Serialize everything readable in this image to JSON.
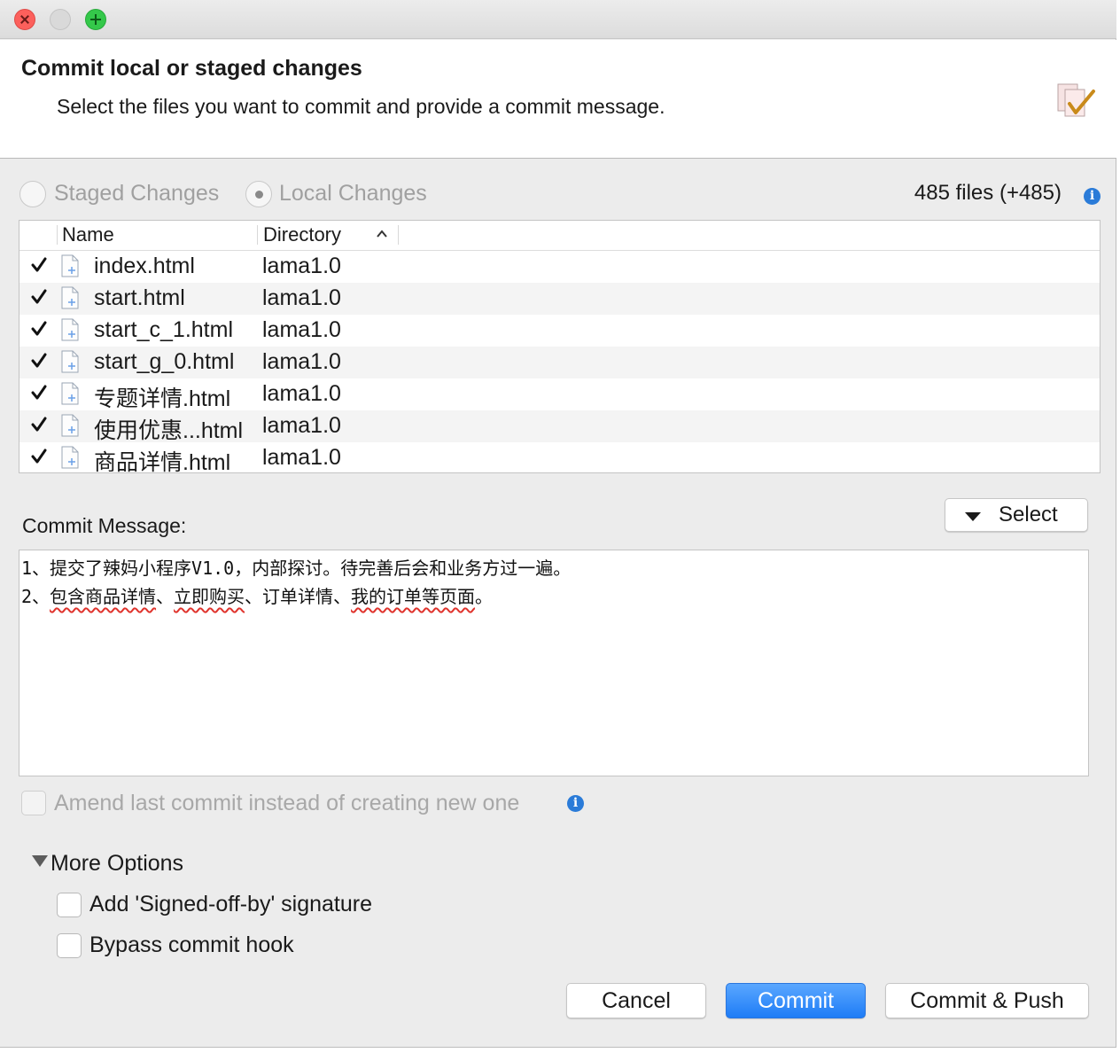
{
  "window": {
    "controls": [
      "close-icon",
      "minimize-icon",
      "maximize-icon"
    ]
  },
  "header": {
    "title": "Commit local or staged changes",
    "description": "Select the files you want to commit and provide a commit message.",
    "icon": "commit-document-check-icon"
  },
  "mode": {
    "staged_label": "Staged Changes",
    "local_label": "Local Changes",
    "selected": "Local Changes",
    "files_count": "485 files (+485)"
  },
  "table": {
    "columns": [
      "Name",
      "Directory"
    ],
    "sort_column": "Directory",
    "rows": [
      {
        "checked": true,
        "name": "index.html",
        "dir": "lama1.0"
      },
      {
        "checked": true,
        "name": "start.html",
        "dir": "lama1.0"
      },
      {
        "checked": true,
        "name": "start_c_1.html",
        "dir": "lama1.0"
      },
      {
        "checked": true,
        "name": "start_g_0.html",
        "dir": "lama1.0"
      },
      {
        "checked": true,
        "name": "专题详情.html",
        "dir": "lama1.0"
      },
      {
        "checked": true,
        "name": "使用优惠...html",
        "dir": "lama1.0"
      },
      {
        "checked": true,
        "name": "商品详情.html",
        "dir": "lama1.0"
      }
    ]
  },
  "commit": {
    "label": "Commit Message:",
    "select_label": "Select",
    "line1": "1、提交了辣妈小程序V1.0，内部探讨。待完善后会和业务方过一遍。",
    "line2_prefix": "2、",
    "line2_a": "包含商品详情",
    "line2_b": "、",
    "line2_c": "立即购买",
    "line2_d": "、订单详情、",
    "line2_e": "我的订单等页面",
    "line2_f": "。"
  },
  "amend": {
    "label": "Amend last commit instead of creating new one",
    "checked": false
  },
  "more_options": {
    "label": "More Options",
    "signed_off_label": "Add 'Signed-off-by' signature",
    "bypass_hook_label": "Bypass commit hook"
  },
  "buttons": {
    "cancel": "Cancel",
    "commit": "Commit",
    "commit_push": "Commit & Push"
  },
  "colors": {
    "primary_button": "#1e7cf6",
    "info_icon": "#2a7bd8",
    "spell_underline": "#e0342d"
  }
}
